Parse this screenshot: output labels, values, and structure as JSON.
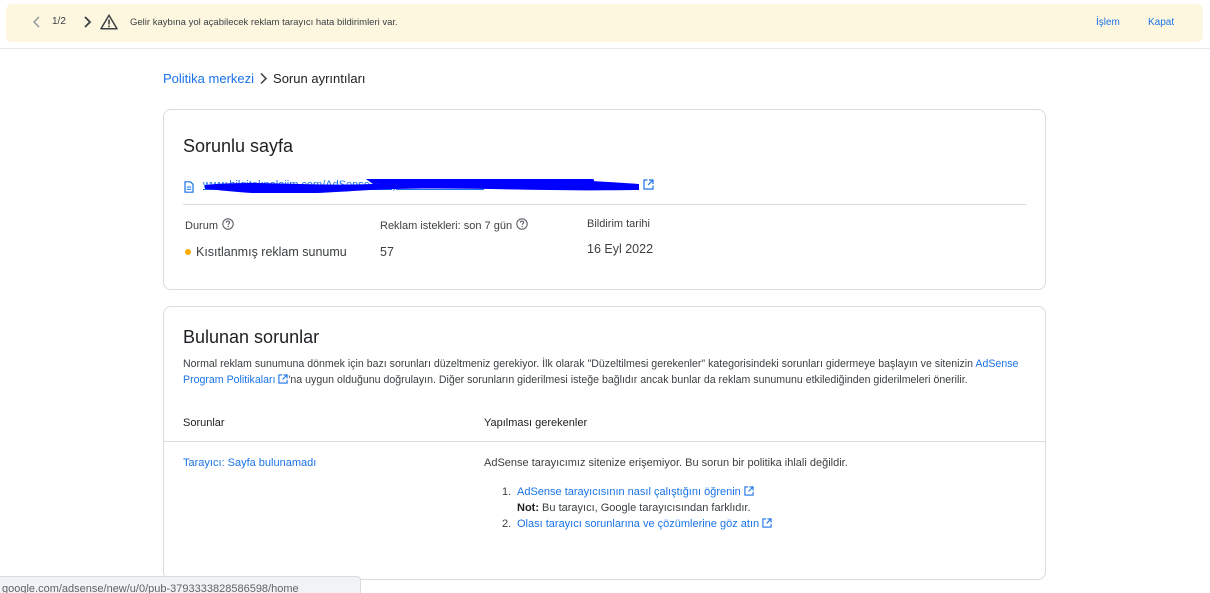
{
  "banner": {
    "counter": "1/2",
    "message": "Gelir kaybına yol açabilecek reklam tarayıcı hata bildirimleri var.",
    "action_label": "İşlem",
    "dismiss_label": "Kapat",
    "icons": [
      "chevron-left-icon",
      "chevron-right-icon",
      "warning-icon"
    ]
  },
  "breadcrumb": {
    "parent": "Politika merkezi",
    "current": "Sorun ayrıntıları"
  },
  "page_card": {
    "title": "Sorunlu sayfa",
    "url": "www.bilgiteknolojim.com/AdSense-tarayici/2022/09/11037",
    "columns": {
      "status_label": "Durum",
      "status_value": "Kısıtlanmış reklam sunumu",
      "status_color": "#f9ab00",
      "requests_label": "Reklam istekleri: son 7 gün",
      "requests_value": "57",
      "date_label": "Bildirim tarihi",
      "date_value": "16 Eyl 2022"
    }
  },
  "issues_card": {
    "title": "Bulunan sorunlar",
    "desc_part1": "Normal reklam sunumuna dönmek için bazı sorunları düzeltmeniz gerekiyor. İlk olarak \"Düzeltilmesi gerekenler\" kategorisindeki sorunları gidermeye başlayın ve sitenizin ",
    "desc_link": "AdSense Program Politikaları",
    "desc_part2": "'na uygun olduğunu doğrulayın. Diğer sorunların giderilmesi isteğe bağlıdır ancak bunlar da reklam sunumunu etkilediğinden giderilmeleri önerilir.",
    "col_issues": "Sorunlar",
    "col_actions": "Yapılması gerekenler",
    "rows": [
      {
        "issue": "Tarayıcı: Sayfa bulunamadı",
        "description": "AdSense tarayıcımız sitenize erişemiyor. Bu sorun bir politika ihlali değildir.",
        "step1_num": "1.",
        "step1_link": "AdSense tarayıcısının nasıl çalıştığını öğrenin",
        "note_label": "Not:",
        "note_text": " Bu tarayıcı, Google tarayıcısından farklıdır.",
        "step2_num": "2.",
        "step2_link": "Olası tarayıcı sorunlarına ve çözümlerine göz atın"
      }
    ]
  },
  "status_bar": {
    "url": "google.com/adsense/new/u/0/pub-3793333828586598/home"
  },
  "colors": {
    "accent": "#1a73e8",
    "banner_bg": "#fef7e0",
    "redaction": "#0000ff"
  }
}
